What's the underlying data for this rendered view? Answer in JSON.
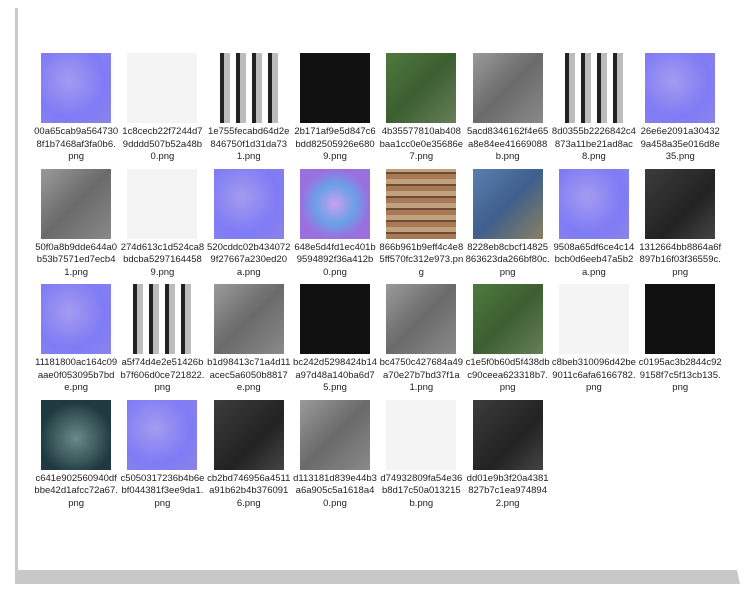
{
  "files": [
    {
      "name": "00a65cab9a5647308f1b7468af3fa0b6.png",
      "thumb": "normal"
    },
    {
      "name": "1c8cecb22f7244d79dddd507b52a48b0.png",
      "thumb": "white"
    },
    {
      "name": "1e755fecabd64d2e846750f1d31da731.png",
      "thumb": "bw"
    },
    {
      "name": "2b171af9e5d847c6bdd82505926e6809.png",
      "thumb": "dark"
    },
    {
      "name": "4b35577810ab408baa1cc0e0e35686e7.png",
      "thumb": "green"
    },
    {
      "name": "5acd8346162f4e65a8e84ee41669088b.png",
      "thumb": "gray"
    },
    {
      "name": "8d0355b2226842c4873a11be21ad8ac8.png",
      "thumb": "bw"
    },
    {
      "name": "26e6e2091a304329a458a35e016d8e35.png",
      "thumb": "normal"
    },
    {
      "name": "50f0a8b9dde644a0b53b7571ed7ecb41.png",
      "thumb": "gray"
    },
    {
      "name": "274d613c1d524ca8bdcba52971644589.png",
      "thumb": "white"
    },
    {
      "name": "520cddc02b4340729f27667a230ed20a.png",
      "thumb": "normal"
    },
    {
      "name": "648e5d4fd1ec401b9594892f36a412b0.png",
      "thumb": "psy"
    },
    {
      "name": "866b961b9eff4c4e85ff570fc312e973.png",
      "thumb": "bricks"
    },
    {
      "name": "8228eb8cbcf14825863623da266bf80c.png",
      "thumb": "blue"
    },
    {
      "name": "9508a65df6ce4c14bcb0d6eeb47a5b2a.png",
      "thumb": "normal"
    },
    {
      "name": "1312664bb8864a6f897b16f03f36559c.png",
      "thumb": "darkgray"
    },
    {
      "name": "11181800ac164c09aae0f053095b7bde.png",
      "thumb": "normal"
    },
    {
      "name": "a5f74d4e2e51426bb7f606d0ce721822.png",
      "thumb": "bw"
    },
    {
      "name": "b1d98413c71a4d11acec5a6050b8817e.png",
      "thumb": "gray"
    },
    {
      "name": "bc242d5298424b14a97d48a140ba6d75.png",
      "thumb": "dark"
    },
    {
      "name": "bc4750c427684a49a70e27b7bd37f1a1.png",
      "thumb": "gray"
    },
    {
      "name": "c1e5f0b60d5f438dbc90ceea623318b7.png",
      "thumb": "green"
    },
    {
      "name": "c8beb310096d42be9011c6afa6166782.png",
      "thumb": "white"
    },
    {
      "name": "c0195ac3b2844c929158f7c5f13cb135.png",
      "thumb": "dark"
    },
    {
      "name": "c641e902560940dfbbe42d1afcc72a67.png",
      "thumb": "teal"
    },
    {
      "name": "c5050317236b4b6ebf044381f3ee9da1.png",
      "thumb": "normal"
    },
    {
      "name": "cb2bd746956a4511a91b62b4b3760916.png",
      "thumb": "darkgray"
    },
    {
      "name": "d113181d839e44b3a6a905c5a1618a40.png",
      "thumb": "gray"
    },
    {
      "name": "d74932809fa54e36b8d17c50a013215b.png",
      "thumb": "white"
    },
    {
      "name": "dd01e9b3f20a4381827b7c1ea9748942.png",
      "thumb": "darkgray"
    }
  ]
}
